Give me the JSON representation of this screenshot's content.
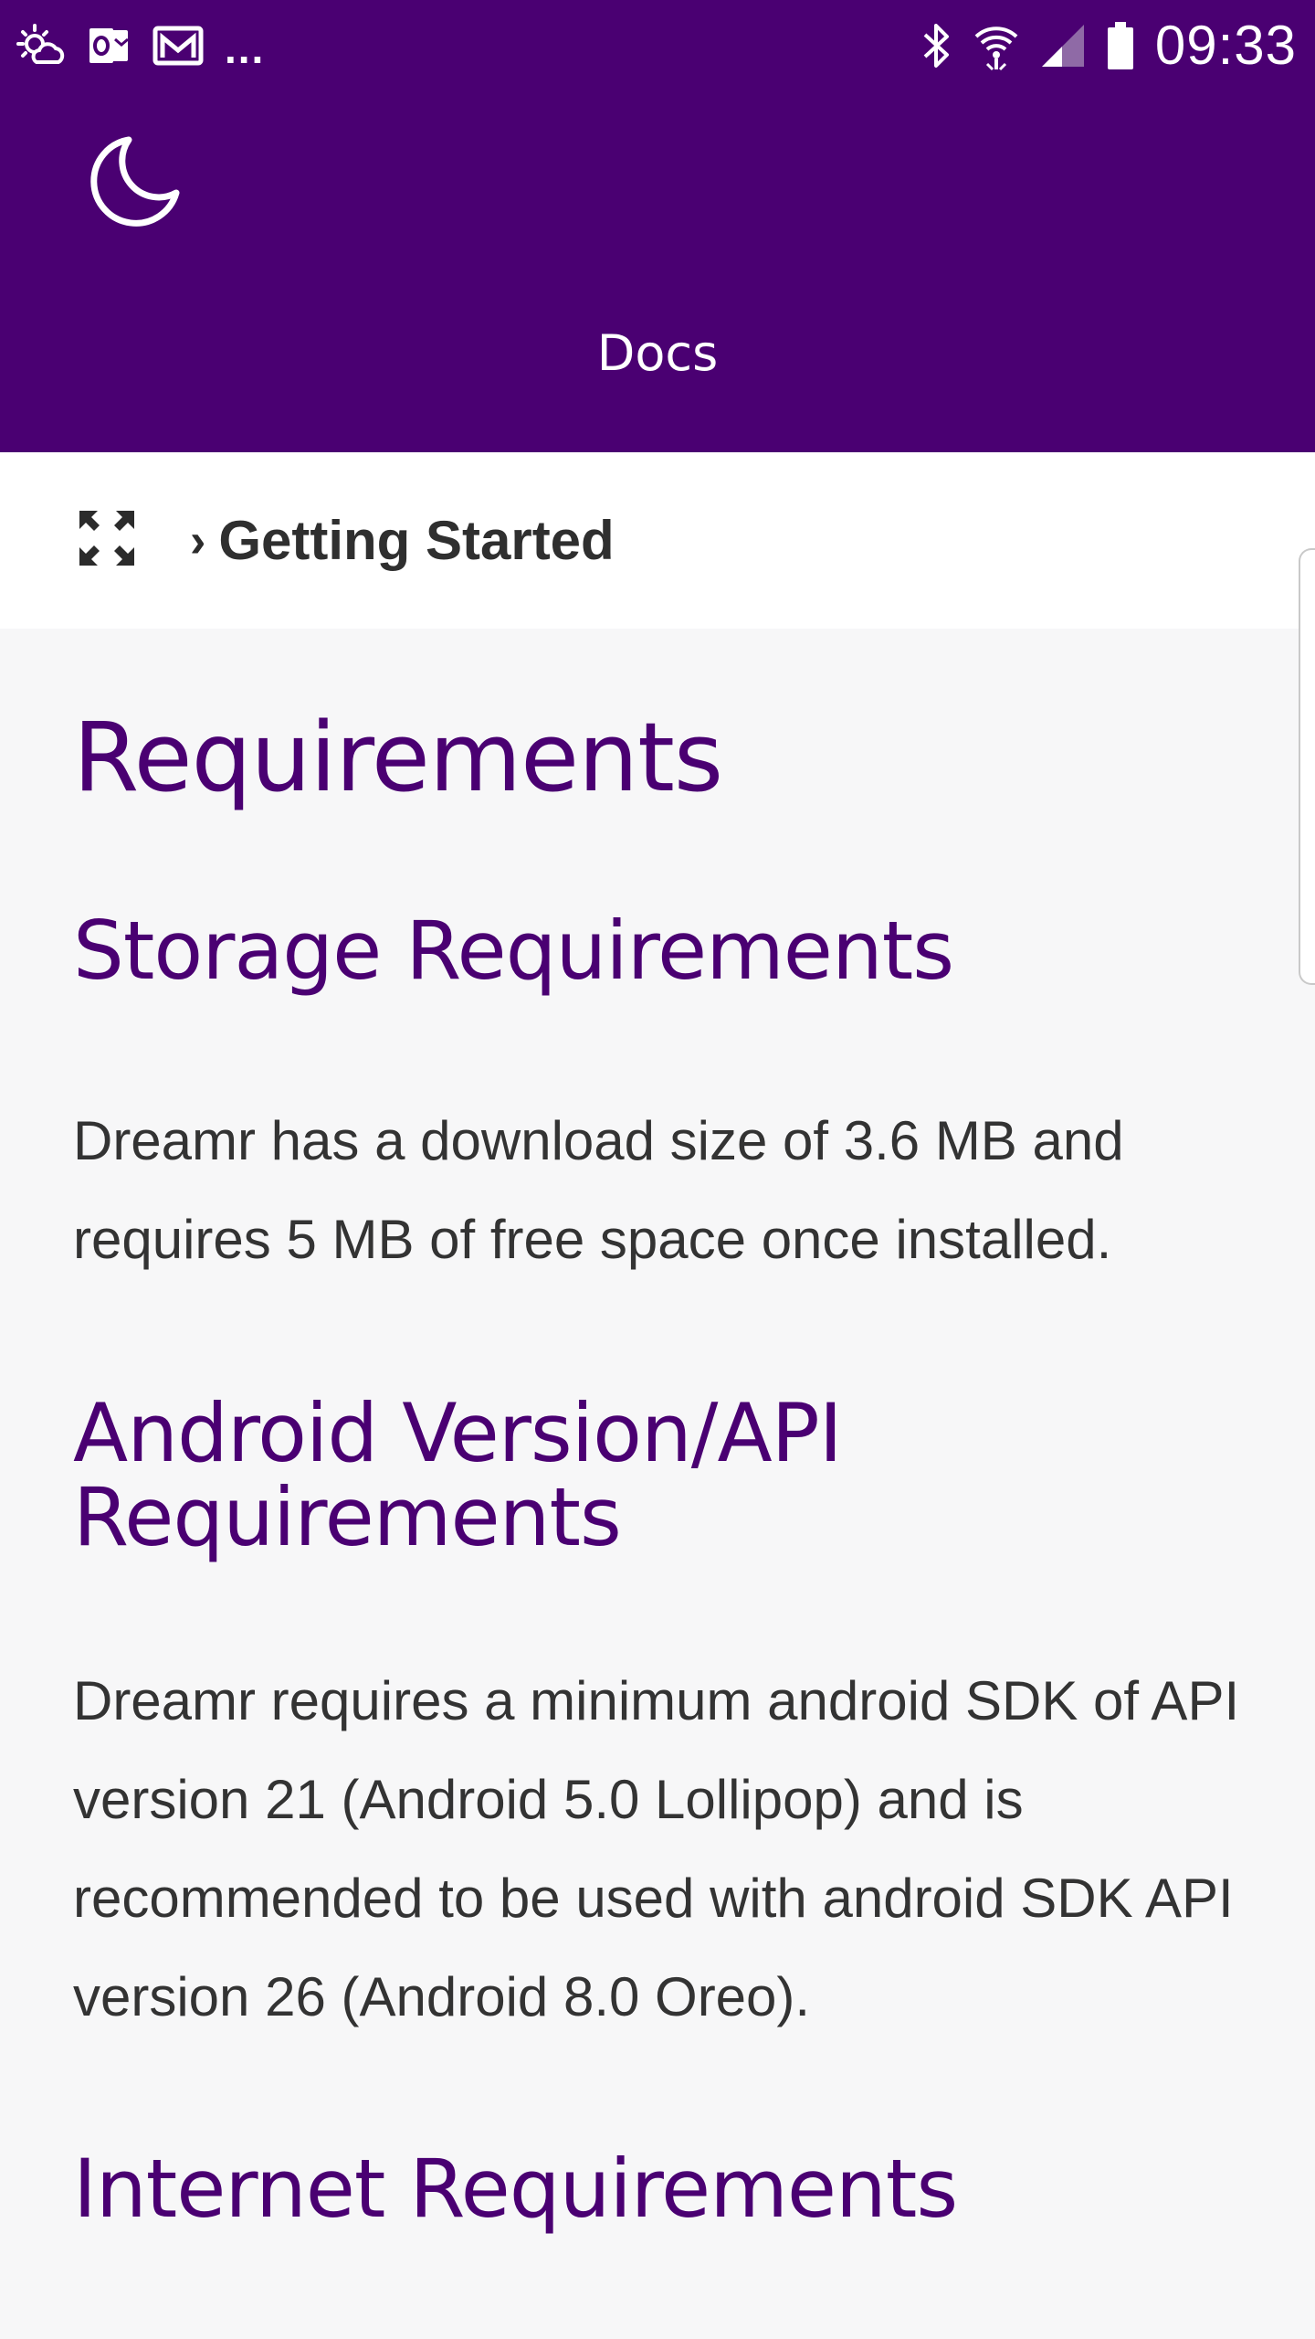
{
  "status_bar": {
    "left_icons": [
      "weather-icon",
      "outlook-icon",
      "mail-icon"
    ],
    "overflow": "...",
    "right_icons": [
      "bluetooth-icon",
      "wifi-icon",
      "signal-icon",
      "battery-icon"
    ],
    "time": "09:33"
  },
  "app_bar": {
    "title": "Docs",
    "theme_toggle_icon": "moon-icon"
  },
  "breadcrumb": {
    "expand_icon": "expand-icon",
    "separator": "›",
    "current": "Getting Started"
  },
  "page": {
    "title": "Requirements",
    "sections": [
      {
        "heading": "Storage Requirements",
        "body": "Dreamr has a download size of 3.6 MB and requires 5 MB of free space once installed."
      },
      {
        "heading": "Android Version/API Requirements",
        "body": "Dreamr requires a minimum android SDK of API version 21 (Android 5.0 Lollipop) and is recommended to be used with android SDK API version 26 (Android 8.0 Oreo)."
      },
      {
        "heading": "Internet Requirements",
        "body": ""
      }
    ]
  },
  "colors": {
    "primary": "#4a0072",
    "background": "#f7f7f8",
    "text": "#333333"
  }
}
